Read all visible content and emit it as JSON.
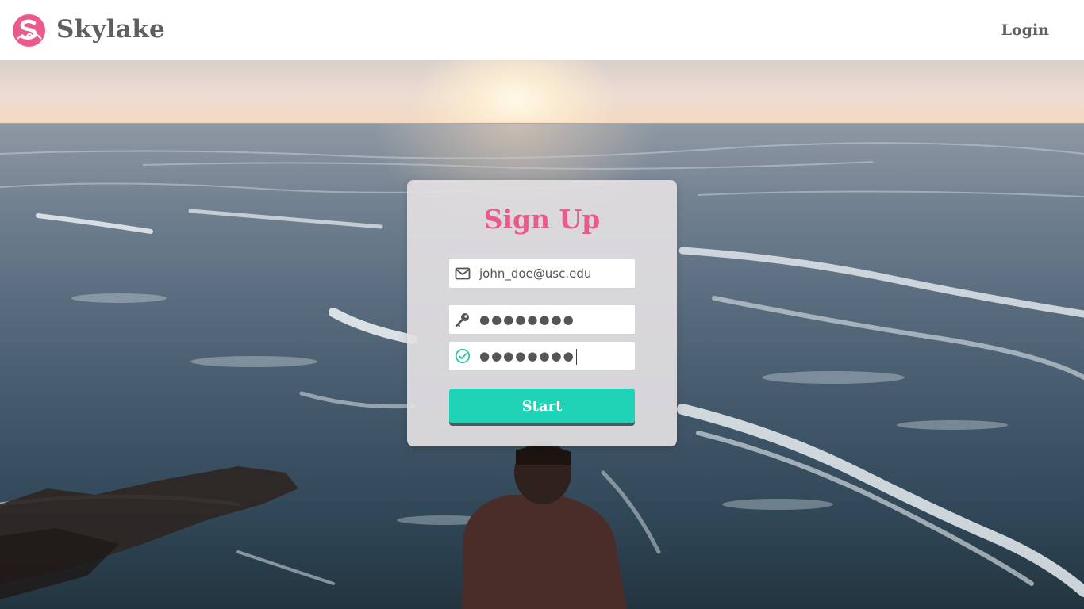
{
  "header": {
    "brand": "Skylake",
    "logo_icon": "skylake-logo-icon",
    "login_label": "Login"
  },
  "form": {
    "title": "Sign Up",
    "email": {
      "icon": "envelope-icon",
      "value": "john_doe@usc.edu"
    },
    "password": {
      "icon": "key-icon",
      "value": "●●●●●●●●"
    },
    "confirm_password": {
      "icon": "check-circle-icon",
      "value": "●●●●●●●●"
    },
    "submit_label": "Start"
  },
  "colors": {
    "accent_pink": "#ea5a8a",
    "button_teal": "#1fd3b7",
    "header_text": "#5f5f5f",
    "confirm_check": "#2bc4a6"
  }
}
